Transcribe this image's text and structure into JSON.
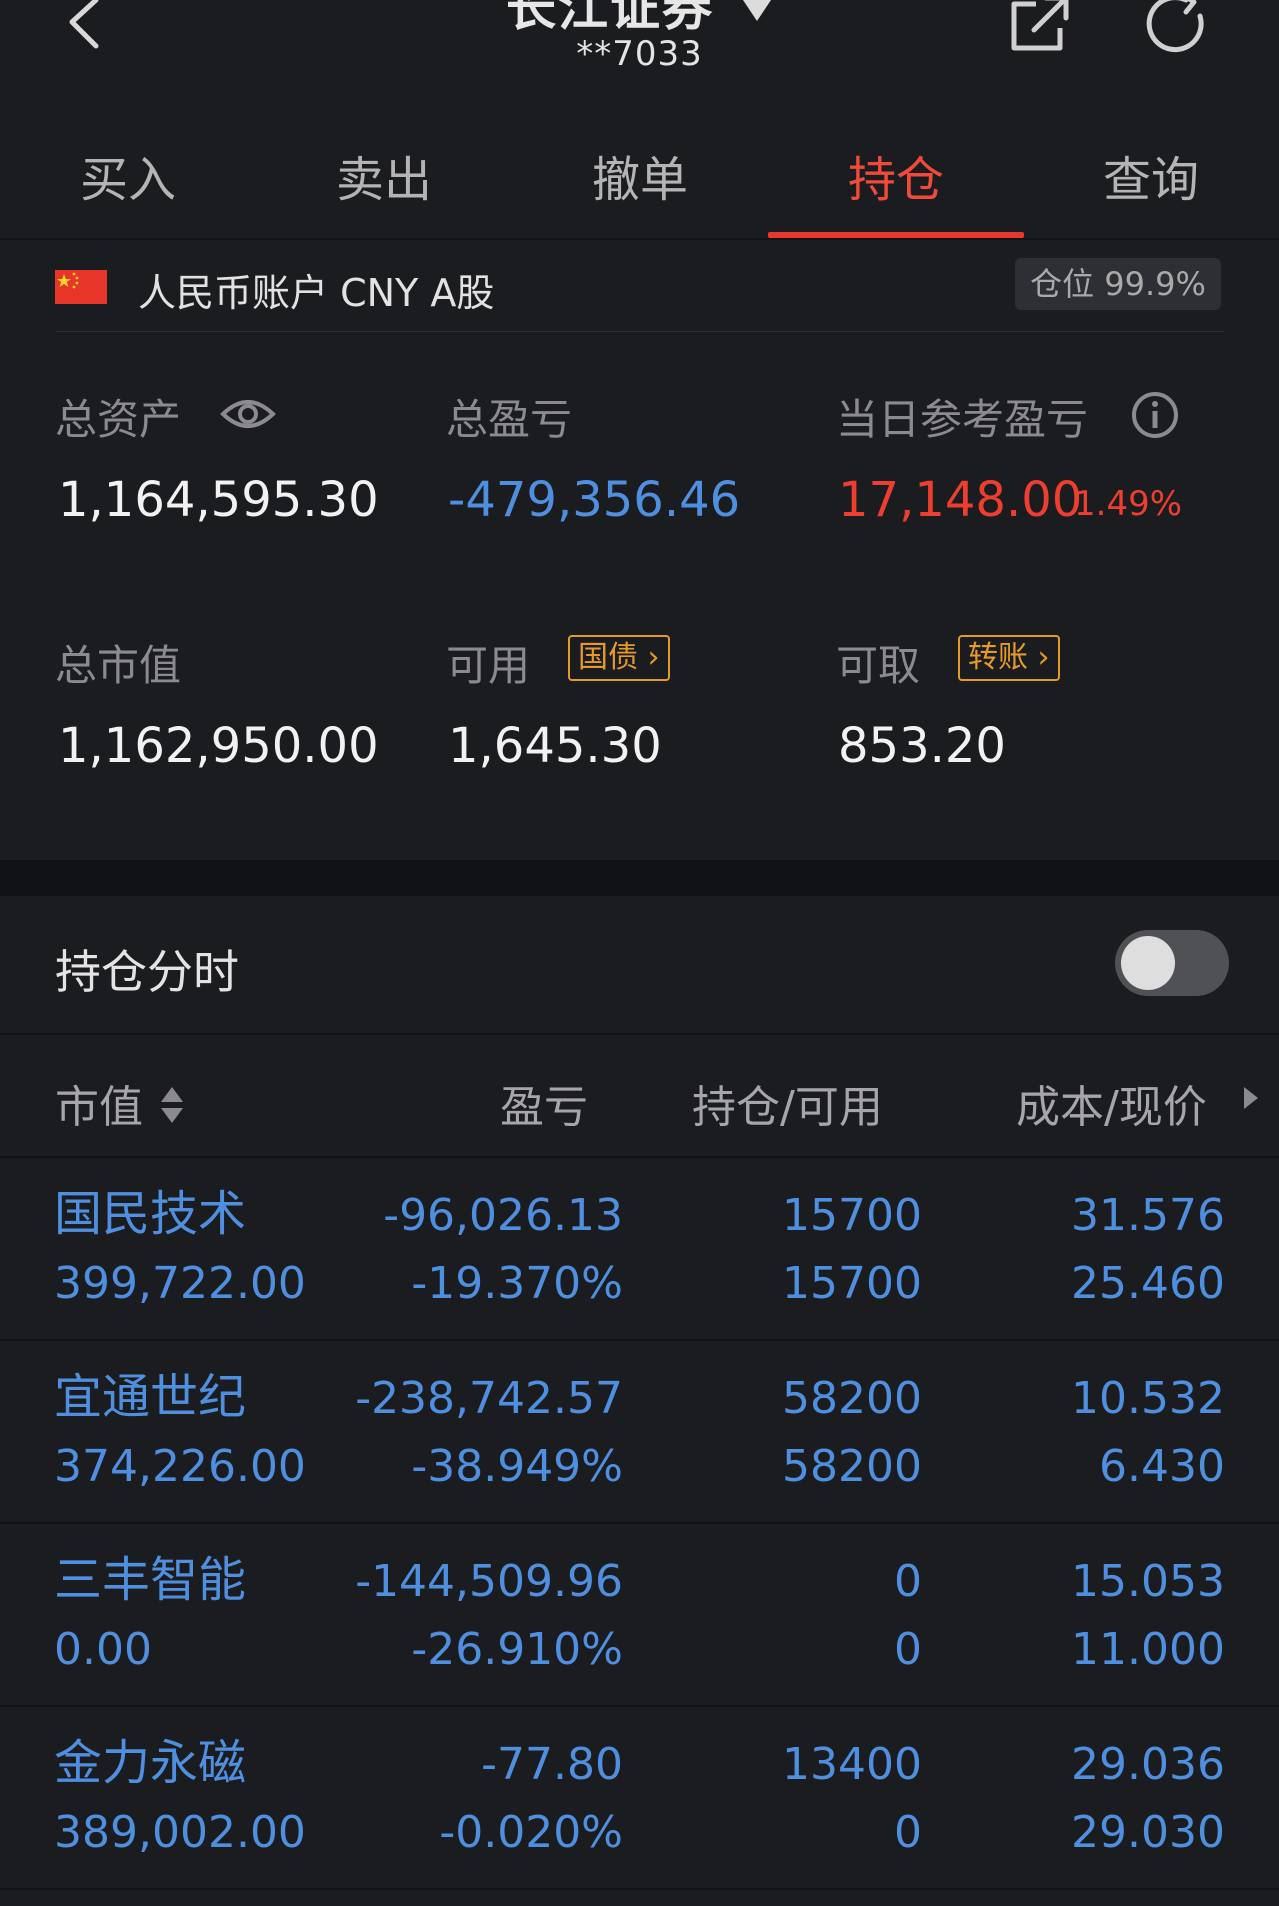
{
  "header": {
    "title": "长江证券",
    "account_no": "**7033",
    "icons": [
      "back-icon",
      "caret-down-icon",
      "share-icon",
      "refresh-icon"
    ]
  },
  "tabs": [
    {
      "label": "买入",
      "active": false
    },
    {
      "label": "卖出",
      "active": false
    },
    {
      "label": "撤单",
      "active": false
    },
    {
      "label": "持仓",
      "active": true
    },
    {
      "label": "查询",
      "active": false
    }
  ],
  "account": {
    "label": "人民币账户 CNY A股",
    "position_badge": "仓位 99.9%",
    "flag": "china-flag-icon"
  },
  "summary": {
    "total_assets_label": "总资产",
    "total_assets": "1,164,595.30",
    "total_pnl_label": "总盈亏",
    "total_pnl": "-479,356.46",
    "today_pnl_label": "当日参考盈亏",
    "today_pnl": "17,148.00",
    "today_pnl_pct": "1.49%",
    "market_value_label": "总市值",
    "market_value": "1,162,950.00",
    "available_label": "可用",
    "available_tag": "国债",
    "available": "1,645.30",
    "withdrawable_label": "可取",
    "withdrawable_tag": "转账",
    "withdrawable": "853.20"
  },
  "toggle": {
    "label": "持仓分时",
    "on": false
  },
  "table": {
    "headers": {
      "market_value": "市值",
      "pnl": "盈亏",
      "position": "持仓/可用",
      "cost_price": "成本/现价"
    },
    "rows": [
      {
        "name": "国民技术",
        "market_value": "399,722.00",
        "pnl": "-96,026.13",
        "pnl_pct": "-19.370%",
        "position": "15700",
        "available": "15700",
        "cost": "31.576",
        "price": "25.460"
      },
      {
        "name": "宜通世纪",
        "market_value": "374,226.00",
        "pnl": "-238,742.57",
        "pnl_pct": "-38.949%",
        "position": "58200",
        "available": "58200",
        "cost": "10.532",
        "price": "6.430"
      },
      {
        "name": "三丰智能",
        "market_value": "0.00",
        "pnl": "-144,509.96",
        "pnl_pct": "-26.910%",
        "position": "0",
        "available": "0",
        "cost": "15.053",
        "price": "11.000"
      },
      {
        "name": "金力永磁",
        "market_value": "389,002.00",
        "pnl": "-77.80",
        "pnl_pct": "-0.020%",
        "position": "13400",
        "available": "0",
        "cost": "29.036",
        "price": "29.030"
      }
    ]
  },
  "colors": {
    "background": "#1b1c20",
    "accent_red": "#ee3e30",
    "loss_blue": "#4f8fe0",
    "tag_orange": "#e59a2a"
  }
}
